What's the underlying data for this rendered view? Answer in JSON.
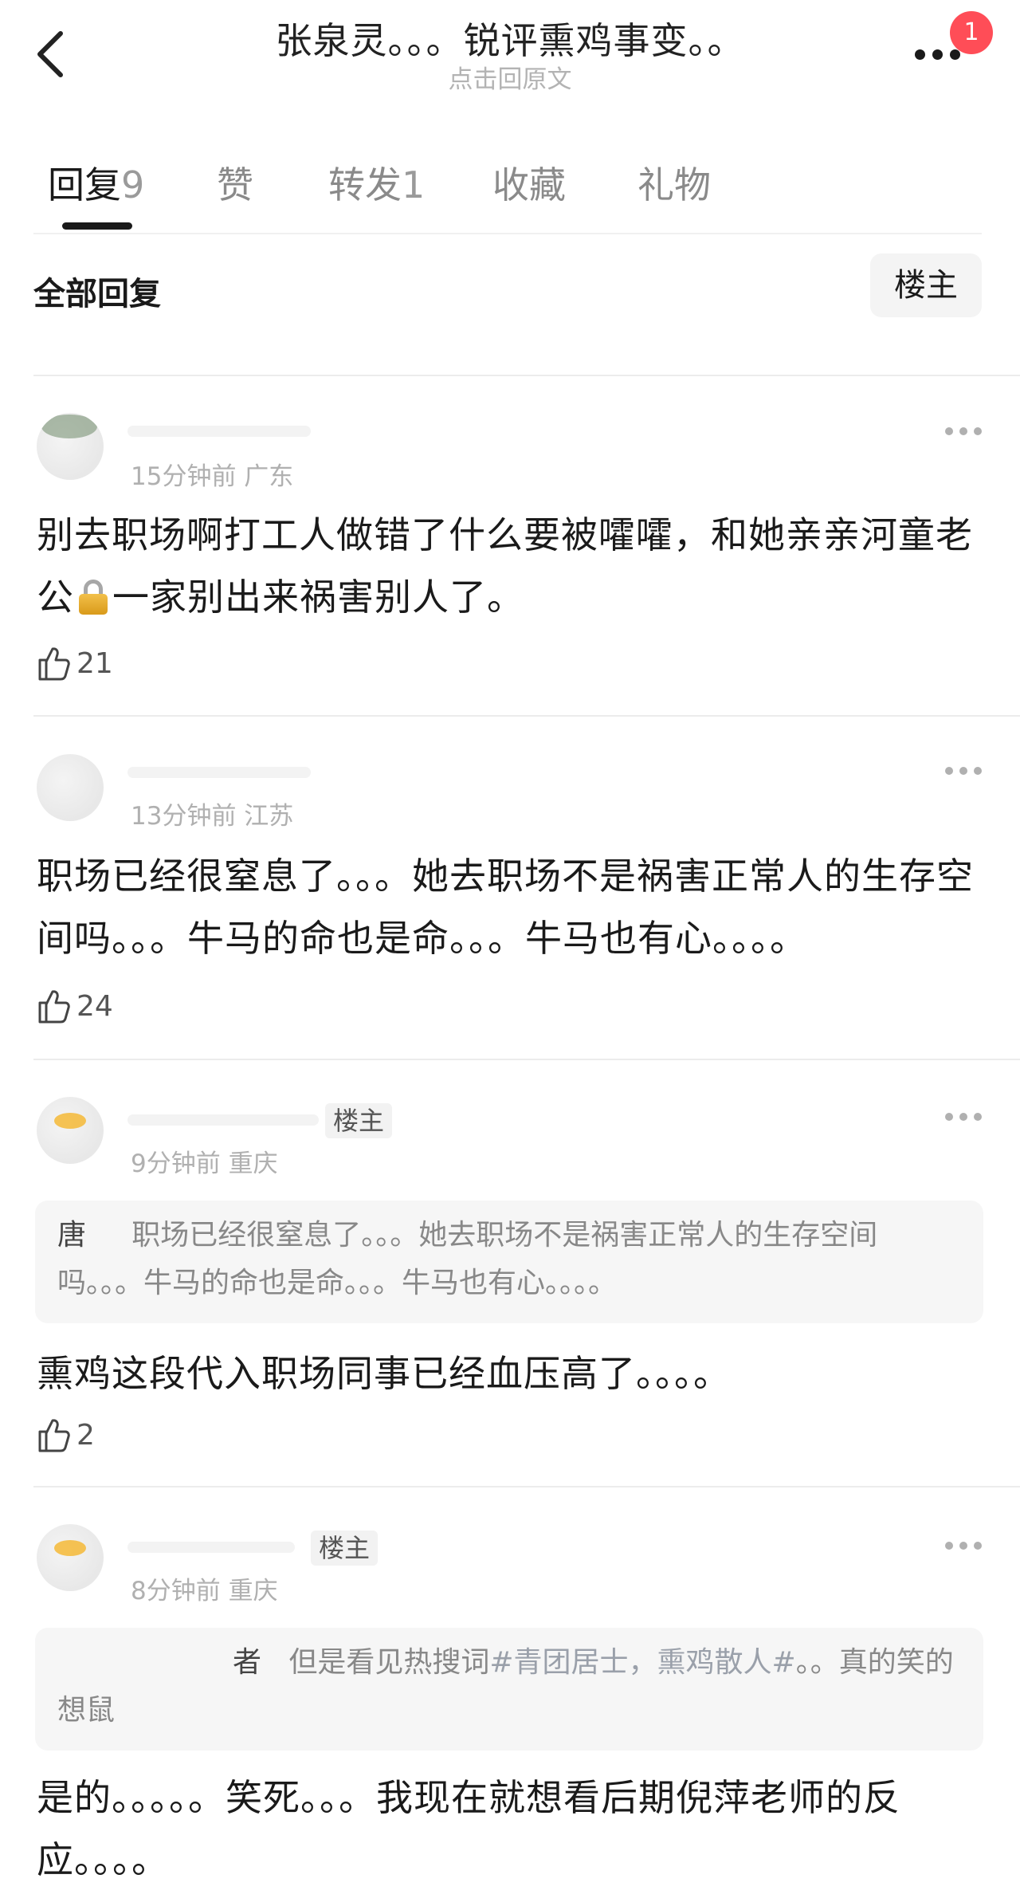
{
  "header": {
    "title": "张泉灵。。。锐评熏鸡事变。。",
    "subtitle": "点击回原文",
    "notification_count": "1"
  },
  "tabs": [
    {
      "label": "回复",
      "count": "9"
    },
    {
      "label": "赞",
      "count": ""
    },
    {
      "label": "转发",
      "count": "1"
    },
    {
      "label": "收藏",
      "count": ""
    },
    {
      "label": "礼物",
      "count": ""
    }
  ],
  "filter": {
    "all_replies": "全部回复",
    "op_only": "楼主"
  },
  "comments": [
    {
      "meta": "15分钟前 广东",
      "text_before_icon": "别去职场啊打工人做错了什么要被嚯嚯，和她亲亲河童老公",
      "icon": "lock-icon",
      "text_after_icon": "一家别出来祸害别人了。",
      "likes": "21"
    },
    {
      "meta": "13分钟前 江苏",
      "text": "职场已经很窒息了。。。她去职场不是祸害正常人的生存空间吗。。。牛马的命也是命。。。牛马也有心。。。。",
      "likes": "24"
    },
    {
      "op_tag": "楼主",
      "meta": "9分钟前 重庆",
      "quote_user": "唐",
      "quote_text": "职场已经很窒息了。。。她去职场不是祸害正常人的生存空间吗。。。牛马的命也是命。。。牛马也有心。。。。",
      "text": "熏鸡这段代入职场同事已经血压高了。。。。",
      "likes": "2"
    },
    {
      "op_tag": "楼主",
      "meta": "8分钟前 重庆",
      "quote_user": "者",
      "quote_text_1": "但是看见热搜词",
      "quote_hashtag": "#青团居士，熏鸡散人#",
      "quote_text_2": "。。真的笑的想鼠",
      "text": "是的。。。。。笑死。。。我现在就想看后期倪萍老师的反应。。。。"
    }
  ],
  "colors": {
    "badge": "#ff4d57",
    "lock_body": "#e0a52a",
    "meta_text": "#b0b0b0",
    "quote_bg": "#f6f6f6"
  }
}
